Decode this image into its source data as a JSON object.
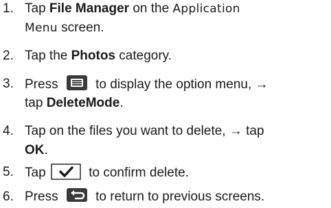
{
  "steps": [
    {
      "number": "1.",
      "lines": [
        {
          "pre": "Tap ",
          "bold": "File Manager",
          "post": " on the "
        },
        {
          "alt": "Menu",
          "post": " screen."
        }
      ],
      "alt_inline": "Application"
    },
    {
      "number": "2.",
      "pre": "Tap the ",
      "bold": "Photos",
      "post": " category."
    },
    {
      "number": "3.",
      "line1_pre": "Press ",
      "line1_post": " to display the option menu, →",
      "line2_pre": "tap ",
      "line2_bold": "DeleteMode",
      "line2_post": ".",
      "icon": "menu-key-icon"
    },
    {
      "number": "4.",
      "line1": "Tap on the files you want to delete, → tap",
      "line2_bold": "OK",
      "line2_post": "."
    },
    {
      "number": "5.",
      "pre": "Tap ",
      "post": " to confirm delete.",
      "icon": "checkmark-button-icon"
    },
    {
      "number": "6.",
      "pre": "Press ",
      "post": " to return to previous screens.",
      "icon": "back-key-icon"
    }
  ]
}
